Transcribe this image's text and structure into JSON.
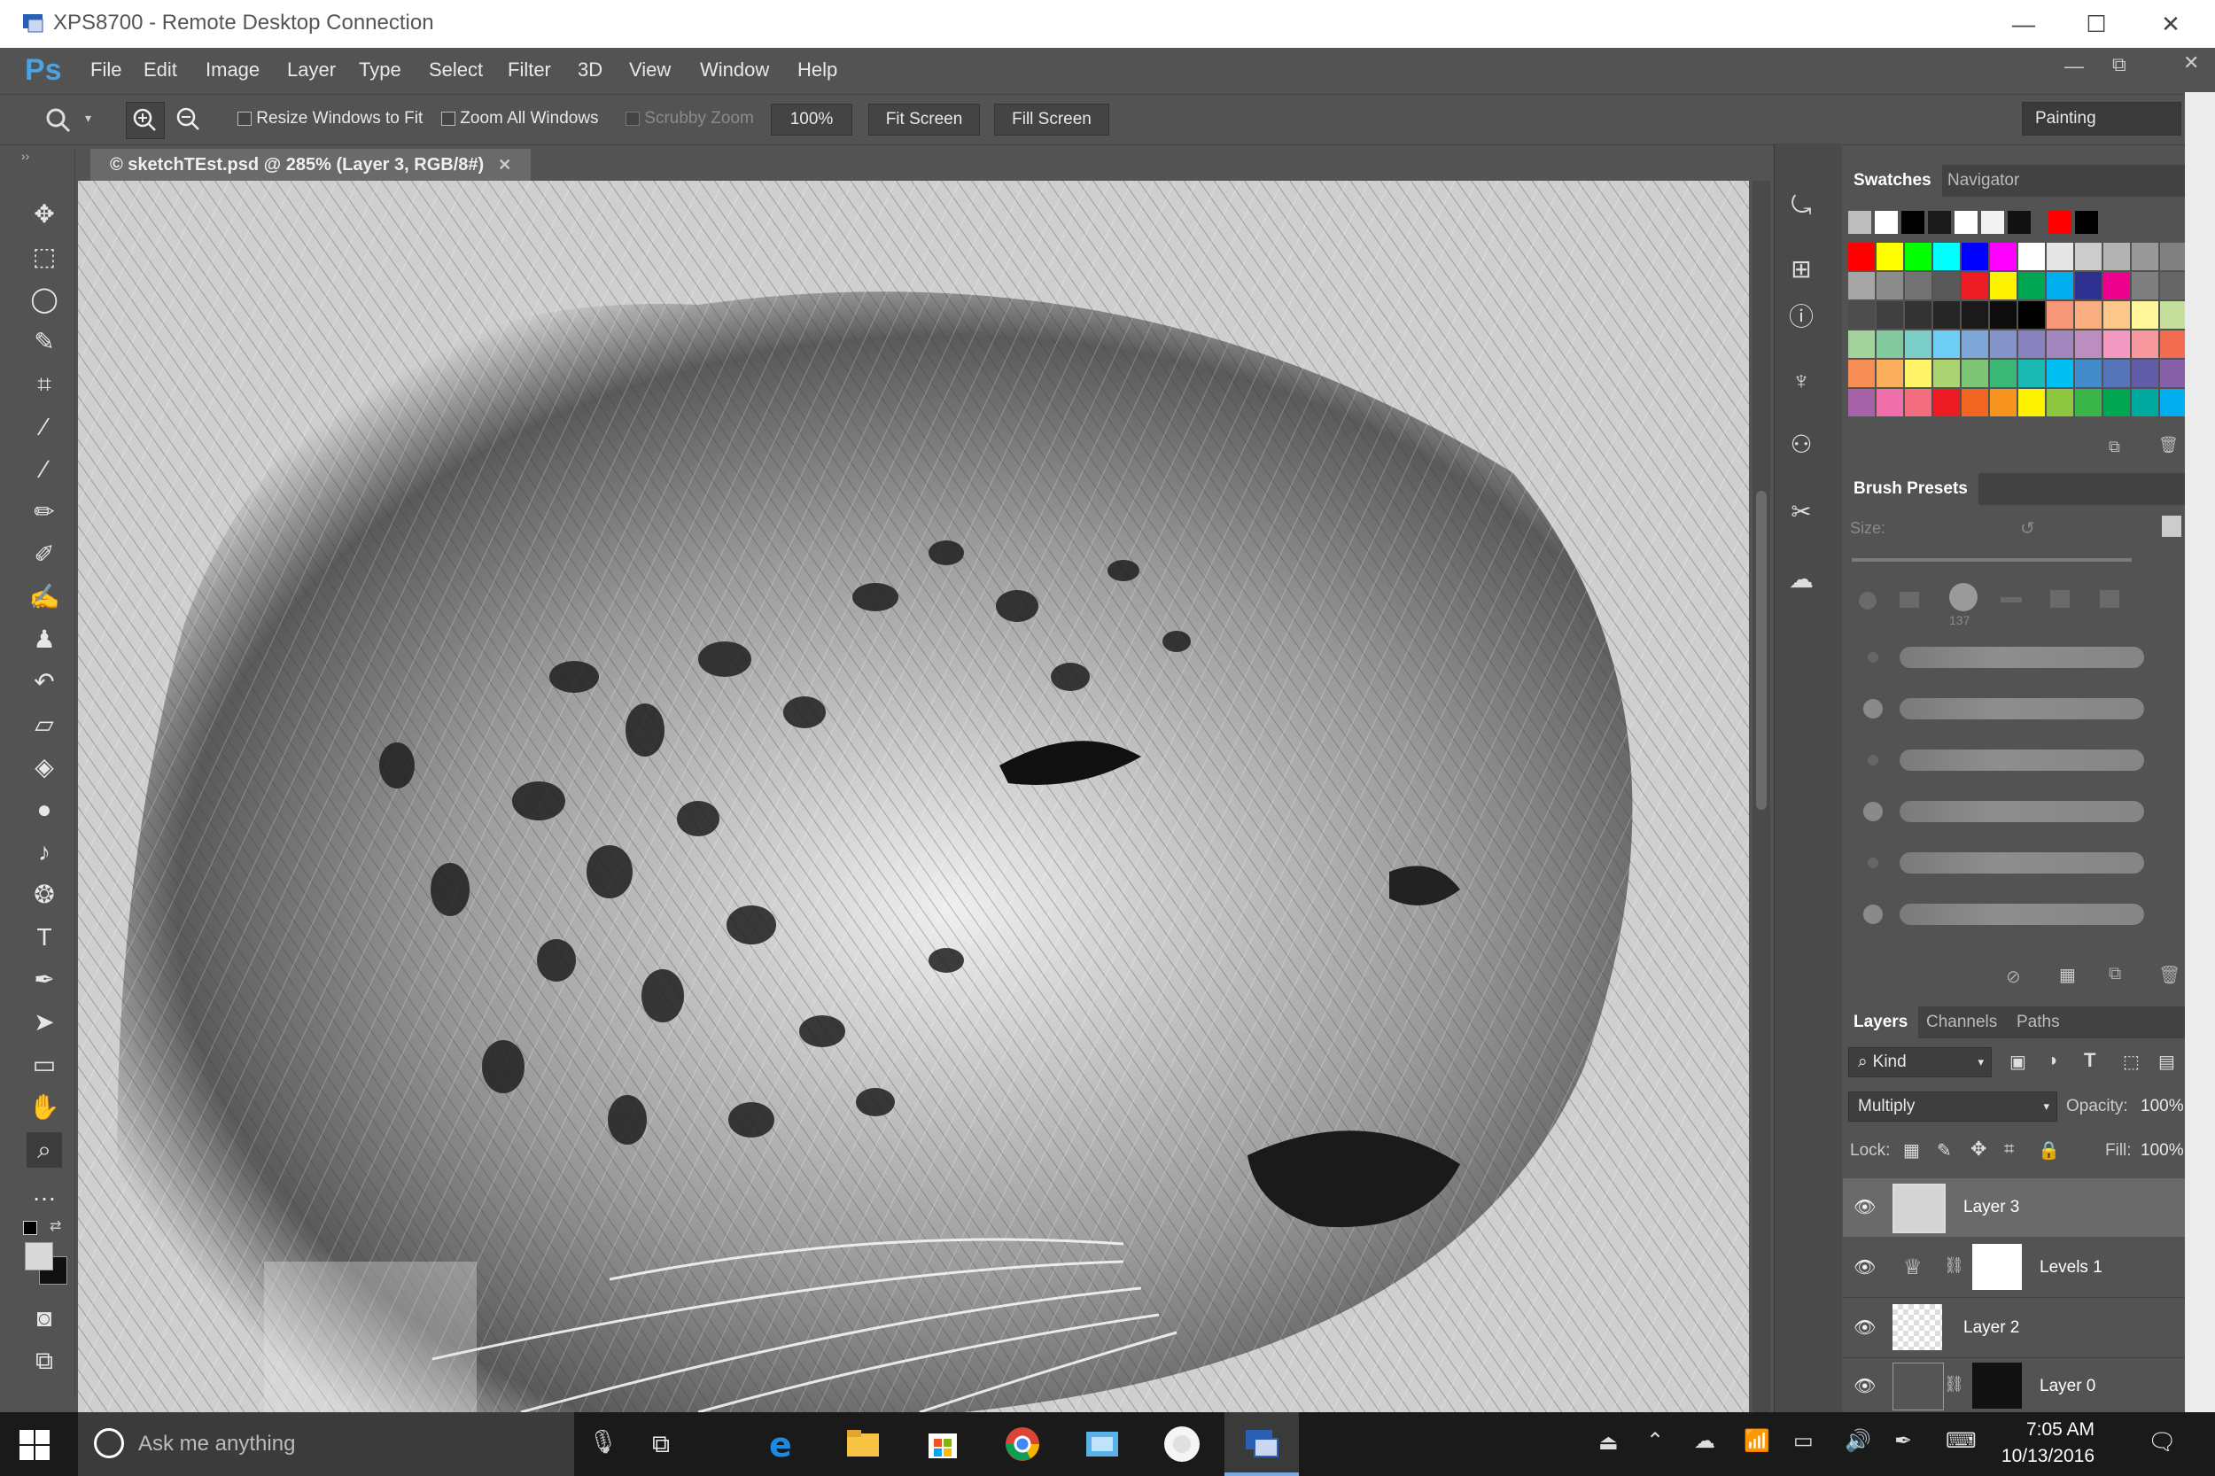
{
  "rdp": {
    "title": "XPS8700 - Remote Desktop Connection"
  },
  "app": {
    "logo": "Ps"
  },
  "menu": [
    "File",
    "Edit",
    "Image",
    "Layer",
    "Type",
    "Select",
    "Filter",
    "3D",
    "View",
    "Window",
    "Help"
  ],
  "options": {
    "resize_windows": "Resize Windows to Fit",
    "zoom_all": "Zoom All Windows",
    "scrubby": "Scrubby Zoom",
    "zoom_value": "100%",
    "fit_screen": "Fit Screen",
    "fill_screen": "Fill Screen",
    "workspace": "Painting"
  },
  "document": {
    "tab_label": "© sketchTEst.psd @ 285% (Layer 3, RGB/8#)"
  },
  "swatches_panel": {
    "tabs": [
      "Swatches",
      "Navigator"
    ],
    "recent": [
      "#bdbdbd",
      "#ffffff",
      "#000000",
      "#1a1a1a",
      "#ffffff",
      "#f2f2f2",
      "#111111",
      "#ff0000",
      "#000000"
    ],
    "rows": [
      [
        "#ff0000",
        "#ffff00",
        "#00ff00",
        "#00ffff",
        "#0000ff",
        "#ff00ff",
        "#ffffff",
        "#e6e6e6",
        "#cccccc",
        "#b3b3b3",
        "#999999",
        "#808080"
      ],
      [
        "#a6a6a6",
        "#8c8c8c",
        "#737373",
        "#595959",
        "#ee1c25",
        "#fff200",
        "#00a651",
        "#00aeef",
        "#2e3192",
        "#ec008c",
        "#7f7f7f",
        "#666666"
      ],
      [
        "#4d4d4d",
        "#404040",
        "#333333",
        "#262626",
        "#1a1a1a",
        "#0d0d0d",
        "#000000",
        "#f7977a",
        "#f9ad81",
        "#fdc68a",
        "#fff79a",
        "#c4df9b"
      ],
      [
        "#a3d39c",
        "#82ca9d",
        "#7bcdc8",
        "#6ecff6",
        "#7ea7d8",
        "#8493ca",
        "#8882be",
        "#a187be",
        "#bc8dbf",
        "#f49ac2",
        "#f6989d",
        "#f26c4f"
      ],
      [
        "#f68e55",
        "#fbaf5c",
        "#fff467",
        "#acd372",
        "#7cc576",
        "#3bb878",
        "#1abbb4",
        "#00bff3",
        "#438ccb",
        "#5574b9",
        "#605ca8",
        "#855fa8"
      ],
      [
        "#a763a8",
        "#f06ea9",
        "#f26d7d",
        "#ed1c24",
        "#f26522",
        "#f7941d",
        "#fff200",
        "#8dc73f",
        "#39b54a",
        "#00a651",
        "#00a99d",
        "#00aeef"
      ]
    ]
  },
  "brush_panel": {
    "title": "Brush Presets",
    "size_label": "Size:",
    "tip_size": "137"
  },
  "layers_panel": {
    "tabs": [
      "Layers",
      "Channels",
      "Paths"
    ],
    "filter_kind": "Kind",
    "blend_mode": "Multiply",
    "opacity_label": "Opacity:",
    "opacity": "100%",
    "lock_label": "Lock:",
    "fill_label": "Fill:",
    "fill": "100%",
    "layers": [
      {
        "name": "Layer 3"
      },
      {
        "name": "Levels 1"
      },
      {
        "name": "Layer 2"
      },
      {
        "name": "Layer 0"
      }
    ]
  },
  "taskbar": {
    "search_placeholder": "Ask me anything",
    "time": "7:05 AM",
    "date": "10/13/2016"
  }
}
